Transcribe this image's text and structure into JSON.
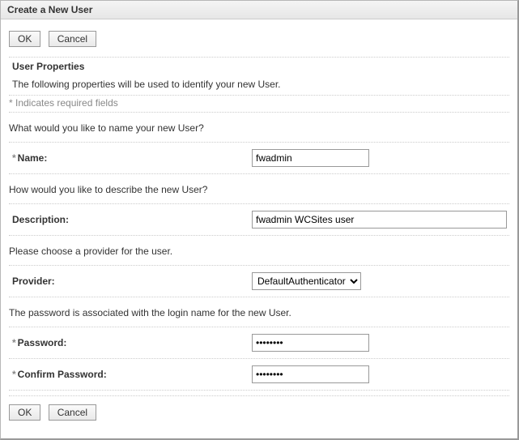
{
  "header": {
    "title": "Create a New User"
  },
  "buttons": {
    "ok": "OK",
    "cancel": "Cancel"
  },
  "section": {
    "title": "User Properties",
    "desc": "The following properties will be used to identify your new User.",
    "requiredNote": "* Indicates required fields"
  },
  "prompts": {
    "name": "What would you like to name your new User?",
    "description": "How would you like to describe the new User?",
    "provider": "Please choose a provider for the user.",
    "password": "The password is associated with the login name for the new User."
  },
  "labels": {
    "name": "Name:",
    "description": "Description:",
    "provider": "Provider:",
    "password": "Password:",
    "confirmPassword": "Confirm Password:",
    "req": "*"
  },
  "values": {
    "name": "fwadmin",
    "description": "fwadmin WCSites user",
    "provider": "DefaultAuthenticator",
    "password": "••••••••",
    "confirmPassword": "••••••••"
  }
}
